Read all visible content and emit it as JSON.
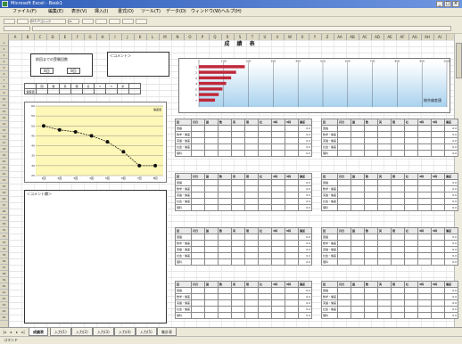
{
  "window": {
    "title": "Microsoft Excel - Book1"
  },
  "menu": [
    "ファイル(F)",
    "編集(E)",
    "表示(V)",
    "挿入(I)",
    "書式(O)",
    "ツール(T)",
    "データ(D)",
    "ウィンドウ(W)",
    "ヘルプ(H)"
  ],
  "toolbar": {
    "font_box": "ＭＳ Ｐゴシック",
    "size_box": "11"
  },
  "columns": [
    "A",
    "B",
    "C",
    "D",
    "E",
    "F",
    "G",
    "H",
    "I",
    "J",
    "K",
    "L",
    "M",
    "N",
    "O",
    "P",
    "Q",
    "R",
    "S",
    "T",
    "U",
    "V",
    "W",
    "X",
    "Y",
    "Z",
    "AA",
    "AB",
    "AC",
    "AD",
    "AE",
    "AF",
    "AG",
    "AH",
    "AI"
  ],
  "rows": [
    "1",
    "2",
    "3",
    "4",
    "5",
    "6",
    "7",
    "8",
    "9",
    "10",
    "11",
    "12",
    "13",
    "14",
    "15",
    "16",
    "17",
    "18",
    "19",
    "20",
    "21",
    "22",
    "23",
    "24",
    "25",
    "26",
    "27",
    "28",
    "29",
    "30",
    "31",
    "32",
    "33",
    "34",
    "35",
    "36",
    "37",
    "38",
    "39",
    "40",
    "41",
    "42",
    "43",
    "44",
    "45"
  ],
  "sheet": {
    "title": "成 績 表",
    "period_label": "前回までの受験回数",
    "period_value_1": "0回",
    "period_value_2": "0回",
    "comment_label": "＜コメント＞",
    "summary_headers": [
      "",
      "国",
      "数",
      "英",
      "理",
      "社",
      "3",
      "5",
      "計",
      ""
    ],
    "summary_row_label": "偏差値"
  },
  "bar_chart": {
    "ticks": [
      "0",
      "100",
      "200",
      "300",
      "400",
      "500",
      "600",
      "700",
      "800",
      "900",
      "1000"
    ],
    "categories": [
      "1",
      "2",
      "3",
      "4",
      "5",
      "6",
      "7"
    ],
    "legend": "総合偏差値",
    "color": "#c0283a"
  },
  "chart_data": [
    {
      "type": "bar",
      "orientation": "horizontal",
      "categories": [
        "1",
        "2",
        "3",
        "4",
        "5",
        "6",
        "7"
      ],
      "values": [
        185,
        150,
        130,
        110,
        95,
        80,
        65
      ],
      "xlim": [
        0,
        1000
      ],
      "grid": true,
      "legend": "総合偏差値"
    },
    {
      "type": "line",
      "categories": [
        "1回",
        "2回",
        "3回",
        "4回",
        "5回",
        "6回",
        "7回",
        "8回"
      ],
      "values": [
        50,
        48,
        47,
        45,
        42,
        37,
        30,
        30
      ],
      "ylim": [
        25,
        60
      ],
      "grid": true
    }
  ],
  "line_chart": {
    "yticks": [
      "60",
      "55",
      "50",
      "45",
      "40",
      "35",
      "30",
      "25"
    ],
    "xticks": [
      "1回",
      "2回",
      "3回",
      "4回",
      "5回",
      "6回",
      "7回",
      "8回"
    ],
    "corner": "偏差値"
  },
  "memo": {
    "label": "＜コメント欄＞"
  },
  "tables": {
    "header": [
      "回",
      "月日",
      "国",
      "数",
      "英",
      "理",
      "社",
      "3科",
      "5科",
      "偏差"
    ],
    "rows": [
      "国語",
      "数学・偏差",
      "英語・偏差",
      "社会・偏差",
      "理科"
    ],
    "cell_value": "0.0"
  },
  "tabs": [
    "成績表",
    "入力(1)",
    "入力(2)",
    "入力(3)",
    "入力(4)",
    "入力(5)",
    "集計表"
  ],
  "status": {
    "text": "コマンド"
  }
}
